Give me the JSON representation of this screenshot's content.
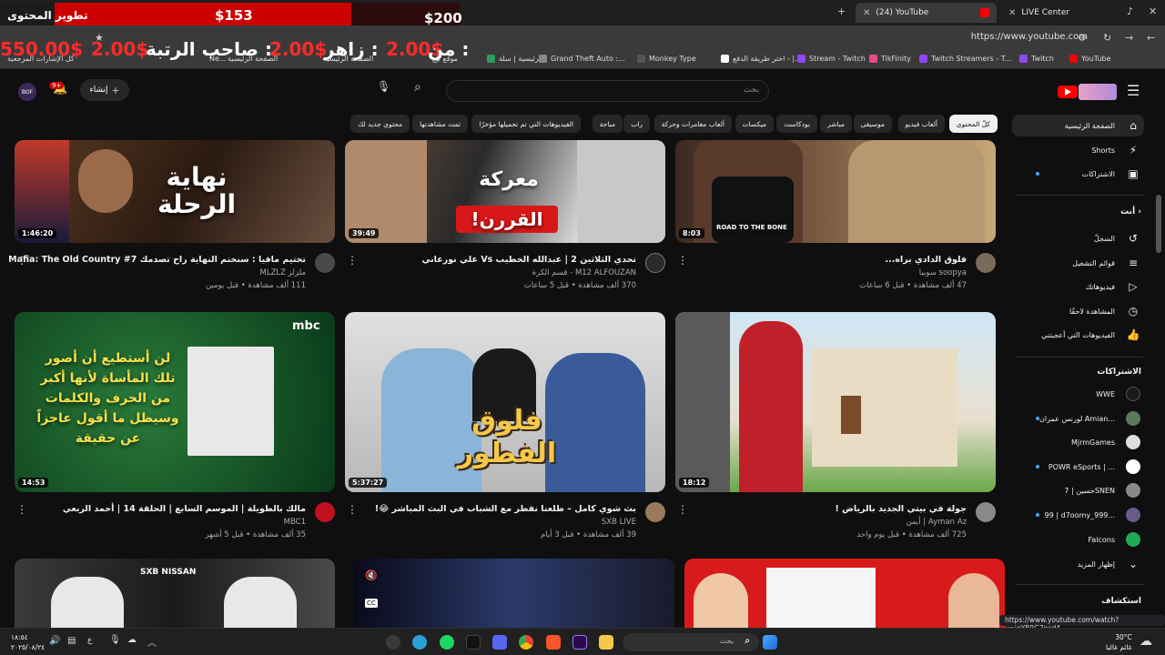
{
  "browser": {
    "tabs": [
      {
        "label": "(24) YouTube",
        "active": true
      },
      {
        "label": "LIVE Center",
        "active": false
      }
    ],
    "new_tab": "+",
    "url": "https://www.youtube.com",
    "bookmarks": [
      "كل الإشارات المرجعية",
      "Ne...",
      "الصفحة الرئيسية",
      "الصفحة الرئيسية",
      "موقع بيع",
      "الرئيسية | سلة",
      "Grand Theft Auto :...",
      "Monkey Type",
      "اختر طريقة الدفع - |...",
      "Stream - Twitch",
      "TikFinity",
      "Twitch Streamers - T...",
      "Twitch",
      "YouTube"
    ],
    "status_url": "https://www.youtube.com/watch?v=jgYB9G7pcd4"
  },
  "overlay": {
    "goal_title": "تطوير المحتوى",
    "goal_current": "$153",
    "goal_target": "$200",
    "ticker": {
      "from_label": "من :",
      "from_amount": "2.00$",
      "zaher_label": "زاهر :",
      "zaher_amount": "2.00$",
      "rank_label": "صاحب الرتبة :",
      "rank_amount": "2.00$",
      "big_amount": "550.00$"
    }
  },
  "youtube": {
    "search_placeholder": "بحث",
    "create_label": "إنشاء",
    "notif_count": "9+",
    "avatar_text": "BOF",
    "chips": [
      {
        "label": "كلّ المحتوى",
        "active": true
      },
      {
        "label": "ألعاب فيديو",
        "active": false
      },
      {
        "label": "موسيقى",
        "active": false
      },
      {
        "label": "مباشر",
        "active": false
      },
      {
        "label": "بودكاست",
        "active": false
      },
      {
        "label": "ميكسات",
        "active": false
      },
      {
        "label": "ألعاب مغامرات وحركة",
        "active": false
      },
      {
        "label": "راب",
        "active": false
      },
      {
        "label": "مباحة",
        "active": false
      },
      {
        "label": "الفيديوهات التي تم تحميلها مؤخرًا",
        "active": false
      },
      {
        "label": "تمت مشاهدتها",
        "active": false
      },
      {
        "label": "محتوى جديد لك",
        "active": false
      }
    ],
    "sidebar": {
      "main": [
        {
          "label": "الصفحة الرئيسية",
          "icon": "home-icon",
          "active": true
        },
        {
          "label": "Shorts",
          "icon": "shorts-icon",
          "active": false
        },
        {
          "label": "الاشتراكات",
          "icon": "subscriptions-icon",
          "active": false
        }
      ],
      "you_header": "أنت",
      "you": [
        {
          "label": "السجلّ",
          "icon": "history-icon"
        },
        {
          "label": "قوائم التشغيل",
          "icon": "playlists-icon"
        },
        {
          "label": "فيديوهاتك",
          "icon": "your-videos-icon"
        },
        {
          "label": "المشاهدة لاحقًا",
          "icon": "watch-later-icon"
        },
        {
          "label": "الفيديوهات التي أعجبتني",
          "icon": "liked-icon"
        }
      ],
      "subs_header": "الاشتراكات",
      "subs": [
        {
          "label": "WWE",
          "color": "#1a1a1a"
        },
        {
          "label": "لورنس عمران Amian...",
          "color": "#5a7a5a"
        },
        {
          "label": "MjrmGames",
          "color": "#dddddd"
        },
        {
          "label": "POWR eSports | ...",
          "color": "#ffffff"
        },
        {
          "label": "حسين | 7SNEN",
          "color": "#888888"
        },
        {
          "label": "99 | d7oomy_999...",
          "color": "#6a5a8a"
        },
        {
          "label": "Falcons",
          "color": "#1faa55"
        }
      ],
      "show_more": "إظهار المزيد",
      "explore_header": "استكشاف"
    },
    "videos": [
      {
        "title": "تختيم مافيا : سنختم النهاية راح تصدمك Mafia: The Old Country #7",
        "channel": "ملزلز MLZLZ",
        "meta": "111 ألف مشاهدة • قبل يومين",
        "duration": "1:46:20",
        "thumb_text": "نهاية الرحلة"
      },
      {
        "title": "تحدي الثلاثين 2 | عبدالله الخطيب Vs علي نورعاني",
        "channel": "M12 ALFOUZAN - قسم الكرة",
        "meta": "370 ألف مشاهدة • قبل 5 ساعات",
        "duration": "39:49",
        "thumb_text": "معركة القررن!"
      },
      {
        "title": "فلوق الدادي براه...",
        "channel": "soopya سوبيا",
        "meta": "47 ألف مشاهدة • قبل 6 ساعات",
        "duration": "8:03",
        "thumb_text": "ROAD TO THE BONE"
      },
      {
        "title": "مالك بالطويلة | الموسم السابع | الحلقة 14 | أحمد الربعي",
        "channel": "MBC1",
        "meta": "35 ألف مشاهدة • قبل 5 أشهر",
        "duration": "14:53",
        "thumb_text": "لن أستطيع أن أصور تلك المأساة لأنها أكبر من الحرف والكلمات وسيظل ما أقول عاجزاً عن حقيقة",
        "logo": "mbc"
      },
      {
        "title": "بث شوي كامل – طلعنا نفطر مع الشباب في البث المباشر 😂!",
        "channel": "SXB LIVE",
        "meta": "39 ألف مشاهدة • قبل 3 أيام",
        "duration": "5:37:27",
        "thumb_text": "فلوق الفطور"
      },
      {
        "title": "جولة في بيتي الجديد بالرياض !",
        "channel": "Ayman Az | أيمن",
        "meta": "725 ألف مشاهدة • قبل يوم واحد",
        "duration": "18:12",
        "thumb_text": ""
      }
    ],
    "row3_brand": "SXB NISSAN"
  },
  "taskbar": {
    "search_label": "بحث",
    "time": "١٨:٥٤",
    "date": "٢٠٢٥/٠٨/٢٤",
    "lang": "ع",
    "temp": "30°C",
    "weather": "غائم غالبا"
  },
  "colors": {
    "bg": "#0f0f0f",
    "accent_red": "#ff0000",
    "overlay_red": "#cc0000"
  }
}
